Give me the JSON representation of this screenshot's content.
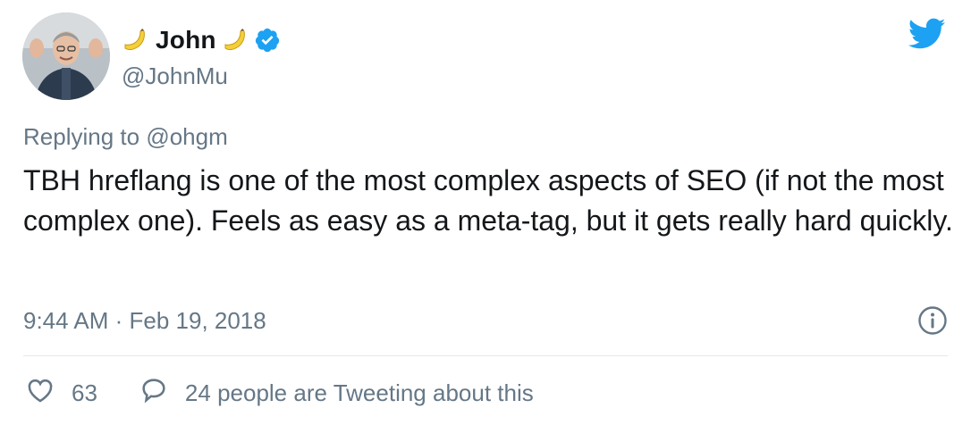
{
  "tweet": {
    "display_name": "John",
    "handle": "@JohnMu",
    "replying_prefix": "Replying to",
    "replying_to": "@ohgm",
    "text": "TBH hreflang is one of the most complex aspects of SEO (if not the most complex one). Feels as easy as a meta-tag, but it gets really hard quickly.",
    "timestamp": "9:44 AM · Feb 19, 2018",
    "likes": "63",
    "activity": "24 people are Tweeting about this"
  },
  "icons": {
    "left_emoji": "banana-icon",
    "right_emoji": "banana-icon",
    "verified": "verified-badge-icon",
    "brand": "twitter-bird-icon",
    "info": "info-icon",
    "like": "heart-icon",
    "reply": "comment-bubble-icon"
  },
  "colors": {
    "brand": "#1da1f2",
    "text": "#14171a",
    "muted": "#657786",
    "divider": "#e1e8ed"
  }
}
